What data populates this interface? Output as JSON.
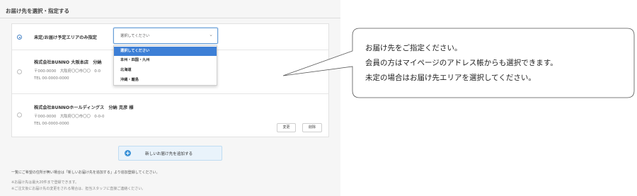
{
  "section": {
    "title": "お届け先を選択・指定する"
  },
  "addresses": {
    "undecided_label": "未定/お届け予定エリアのみ指定",
    "select": {
      "value": "選択してください",
      "options": [
        "選択してください",
        "本州・四国・九州",
        "北海道",
        "沖縄・離島"
      ]
    },
    "rows": [
      {
        "company": "株式会社BUNNO 大阪本店　分納",
        "postal": "〒000-0000　大阪府〇〇市〇〇　0-0",
        "tel": "TEL 00-0000-0000"
      },
      {
        "company": "株式会社BUNNOホールディングス　分納 克彦 様",
        "postal": "〒000-0000　大阪府〇〇市〇〇　0-0-0",
        "tel": "TEL 00-0000-0000",
        "edit_label": "変更",
        "delete_label": "削除"
      }
    ]
  },
  "add_button": {
    "label": "新しいお届け先を追加する"
  },
  "notes": [
    "一覧にご希望の住所が無い場合は「新しいお届け先を追加する」より追加登録してください。",
    "※お届け先は最大20件まで登録できます。",
    "※ご注文後にお届け先の変更をされる場合は、担当スタッフに直接ご連絡ください。"
  ],
  "callout": {
    "lines": [
      "お届け先をご指定ください。",
      "会員の方はマイページのアドレス帳からも選択できます。",
      "未定の場合はお届け先エリアを選択してください。"
    ]
  },
  "colors": {
    "accent": "#3d7fd6",
    "add_button_bg": "#e9f3fb",
    "plus_icon": "#3f94d8"
  }
}
